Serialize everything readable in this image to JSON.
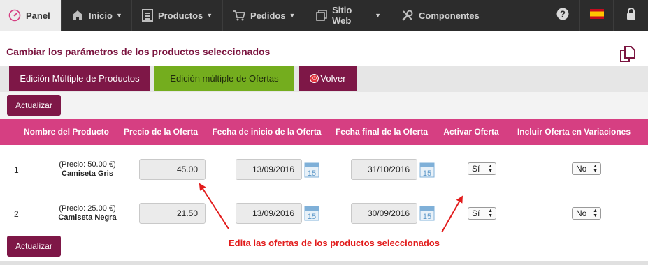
{
  "nav": {
    "items": [
      {
        "label": "Panel",
        "icon": "dashboard-icon"
      },
      {
        "label": "Inicio",
        "icon": "home-icon"
      },
      {
        "label": "Productos",
        "icon": "products-icon"
      },
      {
        "label": "Pedidos",
        "icon": "cart-icon"
      },
      {
        "label": "Sitio Web",
        "icon": "window-icon"
      },
      {
        "label": "Componentes",
        "icon": "tools-icon"
      }
    ],
    "right_icons": [
      "help-icon",
      "spain-flag-icon",
      "lock-icon"
    ]
  },
  "page": {
    "title": "Cambiar los parámetros de los productos seleccionados"
  },
  "tabs": {
    "multi_products": "Edición Múltiple de Productos",
    "multi_offers": "Edición múltiple de Ofertas",
    "back": "Volver"
  },
  "buttons": {
    "update_top": "Actualizar",
    "update_bottom": "Actualizar"
  },
  "table": {
    "headers": [
      "Nombre del Producto",
      "Precio de la Oferta",
      "Fecha de inicio de la Oferta",
      "Fecha final de la Oferta",
      "Activar Oferta",
      "Incluir Oferta en Variaciones"
    ],
    "rows": [
      {
        "index": "1",
        "price_line": "(Precio: 50.00 €)",
        "name": "Camiseta Gris",
        "offer_price": "45.00",
        "start_date": "13/09/2016",
        "end_date": "31/10/2016",
        "active": "Sí",
        "variations": "No",
        "calendar_day": "15"
      },
      {
        "index": "2",
        "price_line": "(Precio: 25.00 €)",
        "name": "Camiseta Negra",
        "offer_price": "21.50",
        "start_date": "13/09/2016",
        "end_date": "30/09/2016",
        "active": "Sí",
        "variations": "No",
        "calendar_day": "15"
      }
    ]
  },
  "annotation": {
    "text": "Edita las ofertas de los productos seleccionados",
    "color": "#e21b1b"
  },
  "colors": {
    "brand": "#7e1747",
    "header_pink": "#d63f82",
    "active_tab": "#74ad1e",
    "nav_bg": "#2c2c2c"
  }
}
